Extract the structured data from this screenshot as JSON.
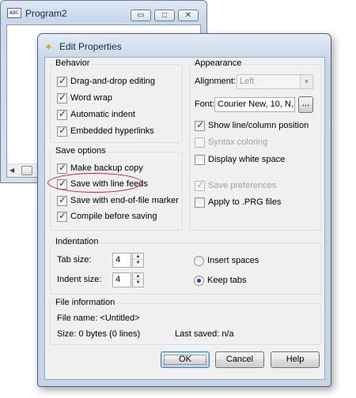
{
  "background_window": {
    "title": "Program2",
    "icon_text": "ABC",
    "minimize": "▭",
    "maximize": "□",
    "close": "✕"
  },
  "dialog": {
    "title": "Edit Properties",
    "close": "✕",
    "behavior": {
      "legend": "Behavior",
      "items": [
        {
          "label": "Drag-and-drop editing",
          "checked": true
        },
        {
          "label": "Word wrap",
          "checked": true
        },
        {
          "label": "Automatic indent",
          "checked": true
        },
        {
          "label": "Embedded hyperlinks",
          "checked": true
        }
      ]
    },
    "save_options": {
      "legend": "Save options",
      "items": [
        {
          "label": "Make backup copy",
          "checked": true
        },
        {
          "label": "Save with line feeds",
          "checked": true
        },
        {
          "label": "Save with end-of-file marker",
          "checked": true
        },
        {
          "label": "Compile before saving",
          "checked": true
        }
      ]
    },
    "appearance": {
      "legend": "Appearance",
      "alignment_label": "Alignment:",
      "alignment_value": "Left",
      "font_label": "Font:",
      "font_value": "Courier New, 10, N,",
      "font_button": "...",
      "options": [
        {
          "label": "Show line/column position",
          "checked": true,
          "disabled": false
        },
        {
          "label": "Syntax coloring",
          "checked": false,
          "disabled": true
        },
        {
          "label": "Display white space",
          "checked": false,
          "disabled": false
        },
        {
          "label": "Save preferences",
          "checked": true,
          "disabled": true
        },
        {
          "label": "Apply to .PRG files",
          "checked": false,
          "disabled": false
        }
      ]
    },
    "indentation": {
      "legend": "Indentation",
      "tab_size_label": "Tab size:",
      "tab_size_value": "4",
      "indent_size_label": "Indent size:",
      "indent_size_value": "4",
      "insert_spaces_label": "Insert spaces",
      "keep_tabs_label": "Keep tabs",
      "selected": "keep_tabs"
    },
    "file_information": {
      "legend": "File information",
      "file_name": "File name:  <Untitled>",
      "size": "Size: 0 bytes (0 lines)",
      "last_saved": "Last saved:  n/a"
    },
    "buttons": {
      "ok": "OK",
      "cancel": "Cancel",
      "help": "Help"
    }
  }
}
